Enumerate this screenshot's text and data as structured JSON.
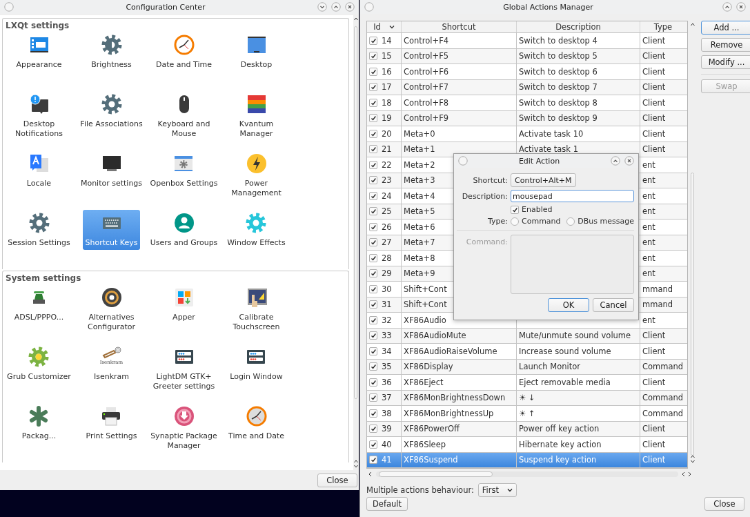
{
  "config_center": {
    "title": "Configuration Center",
    "groups": [
      {
        "title": "LXQt settings",
        "items": [
          {
            "label": "Appearance",
            "selected": false
          },
          {
            "label": "Brightness",
            "selected": false
          },
          {
            "label": "Date and Time",
            "selected": false
          },
          {
            "label": "Desktop",
            "selected": false
          },
          {
            "label": "Desktop Notifications",
            "selected": false
          },
          {
            "label": "File Associations",
            "selected": false
          },
          {
            "label": "Keyboard and Mouse",
            "selected": false
          },
          {
            "label": "Kvantum Manager",
            "selected": false
          },
          {
            "label": "Locale",
            "selected": false
          },
          {
            "label": "Monitor settings",
            "selected": false
          },
          {
            "label": "Openbox Settings",
            "selected": false
          },
          {
            "label": "Power Management",
            "selected": false
          },
          {
            "label": "Session Settings",
            "selected": false
          },
          {
            "label": "Shortcut Keys",
            "selected": true
          },
          {
            "label": "Users and Groups",
            "selected": false
          },
          {
            "label": "Window Effects",
            "selected": false
          }
        ]
      },
      {
        "title": "System settings",
        "items": [
          {
            "label": "ADSL/PPPO...",
            "selected": false
          },
          {
            "label": "Alternatives Configurator",
            "selected": false
          },
          {
            "label": "Apper",
            "selected": false
          },
          {
            "label": "Calibrate Touchscreen",
            "selected": false
          },
          {
            "label": "Grub Customizer",
            "selected": false
          },
          {
            "label": "Isenkram",
            "icon_text": "Isenkram",
            "selected": false
          },
          {
            "label": "LightDM GTK+ Greeter settings",
            "selected": false
          },
          {
            "label": "Login Window",
            "selected": false
          },
          {
            "label": "Packag...",
            "selected": false
          },
          {
            "label": "Print Settings",
            "selected": false
          },
          {
            "label": "Synaptic Package Manager",
            "selected": false
          },
          {
            "label": "Time and Date",
            "selected": false
          }
        ]
      }
    ],
    "close_button": "Close"
  },
  "actions_manager": {
    "title": "Global Actions Manager",
    "columns": [
      "Id",
      "Shortcut",
      "Description",
      "Type"
    ],
    "rows": [
      {
        "id": "14",
        "checked": true,
        "shortcut": "Control+F4",
        "description": "Switch to desktop 4",
        "type": "Client",
        "selected": false
      },
      {
        "id": "15",
        "checked": true,
        "shortcut": "Control+F5",
        "description": "Switch to desktop 5",
        "type": "Client",
        "selected": false
      },
      {
        "id": "16",
        "checked": true,
        "shortcut": "Control+F6",
        "description": "Switch to desktop 6",
        "type": "Client",
        "selected": false
      },
      {
        "id": "17",
        "checked": true,
        "shortcut": "Control+F7",
        "description": "Switch to desktop 7",
        "type": "Client",
        "selected": false
      },
      {
        "id": "18",
        "checked": true,
        "shortcut": "Control+F8",
        "description": "Switch to desktop 8",
        "type": "Client",
        "selected": false
      },
      {
        "id": "19",
        "checked": true,
        "shortcut": "Control+F9",
        "description": "Switch to desktop 9",
        "type": "Client",
        "selected": false
      },
      {
        "id": "20",
        "checked": true,
        "shortcut": "Meta+0",
        "description": "Activate task 10",
        "type": "Client",
        "selected": false
      },
      {
        "id": "21",
        "checked": true,
        "shortcut": "Meta+1",
        "description": "Activate task 1",
        "type": "Client",
        "selected": false
      },
      {
        "id": "22",
        "checked": true,
        "shortcut": "Meta+2",
        "type": "ent",
        "selected": false
      },
      {
        "id": "23",
        "checked": true,
        "shortcut": "Meta+3",
        "type": "ent",
        "selected": false
      },
      {
        "id": "24",
        "checked": true,
        "shortcut": "Meta+4",
        "type": "ent",
        "selected": false
      },
      {
        "id": "25",
        "checked": true,
        "shortcut": "Meta+5",
        "type": "ent",
        "selected": false
      },
      {
        "id": "26",
        "checked": true,
        "shortcut": "Meta+6",
        "type": "ent",
        "selected": false
      },
      {
        "id": "27",
        "checked": true,
        "shortcut": "Meta+7",
        "type": "ent",
        "selected": false
      },
      {
        "id": "28",
        "checked": true,
        "shortcut": "Meta+8",
        "type": "ent",
        "selected": false
      },
      {
        "id": "29",
        "checked": true,
        "shortcut": "Meta+9",
        "type": "ent",
        "selected": false
      },
      {
        "id": "30",
        "checked": true,
        "shortcut": "Shift+Cont",
        "type": "mmand",
        "selected": false
      },
      {
        "id": "31",
        "checked": true,
        "shortcut": "Shift+Cont",
        "type": "mmand",
        "selected": false
      },
      {
        "id": "32",
        "checked": true,
        "shortcut": "XF86Audio",
        "type": "ent",
        "selected": false
      },
      {
        "id": "33",
        "checked": true,
        "shortcut": "XF86AudioMute",
        "description": "Mute/unmute sound volume",
        "type": "Client",
        "selected": false
      },
      {
        "id": "34",
        "checked": true,
        "shortcut": "XF86AudioRaiseVolume",
        "description": "Increase sound volume",
        "type": "Client",
        "selected": false
      },
      {
        "id": "35",
        "checked": true,
        "shortcut": "XF86Display",
        "description": "Launch Monitor",
        "type": "Command",
        "selected": false
      },
      {
        "id": "36",
        "checked": true,
        "shortcut": "XF86Eject",
        "description": "Eject removable media",
        "type": "Client",
        "selected": false
      },
      {
        "id": "37",
        "checked": true,
        "shortcut": "XF86MonBrightnessDown",
        "description": "☀ ↓",
        "type": "Command",
        "selected": false
      },
      {
        "id": "38",
        "checked": true,
        "shortcut": "XF86MonBrightnessUp",
        "description": "☀ ↑",
        "type": "Command",
        "selected": false
      },
      {
        "id": "39",
        "checked": true,
        "shortcut": "XF86PowerOff",
        "description": "Power off key action",
        "type": "Client",
        "selected": false
      },
      {
        "id": "40",
        "checked": true,
        "shortcut": "XF86Sleep",
        "description": "Hibernate key action",
        "type": "Client",
        "selected": false
      },
      {
        "id": "41",
        "checked": true,
        "shortcut": "XF86Suspend",
        "description": "Suspend key action",
        "type": "Client",
        "selected": true
      }
    ],
    "buttons": [
      {
        "label": "Add ...",
        "focused": true,
        "disabled": false
      },
      {
        "label": "Remove",
        "focused": false,
        "disabled": false
      },
      {
        "label": "Modify ...",
        "focused": false,
        "disabled": false
      },
      {
        "label": "Swap",
        "focused": false,
        "disabled": true
      }
    ],
    "behaviour": {
      "label": "Multiple actions behaviour:",
      "value": "First"
    },
    "default_button": "Default",
    "close_button": "Close"
  },
  "edit_action": {
    "title": "Edit Action",
    "shortcut_label": "Shortcut:",
    "shortcut": "Control+Alt+M",
    "description_label": "Description:",
    "description": "mousepad",
    "enabled": {
      "label": "Enabled",
      "checked": true
    },
    "type_label": "Type:",
    "type_options": [
      {
        "label": "Command",
        "selected": false
      },
      {
        "label": "DBus message",
        "selected": false
      }
    ],
    "command": {
      "label": "Command:",
      "disabled": true
    },
    "buttons": [
      {
        "label": "OK",
        "focused": true
      },
      {
        "label": "Cancel",
        "focused": false
      }
    ]
  }
}
